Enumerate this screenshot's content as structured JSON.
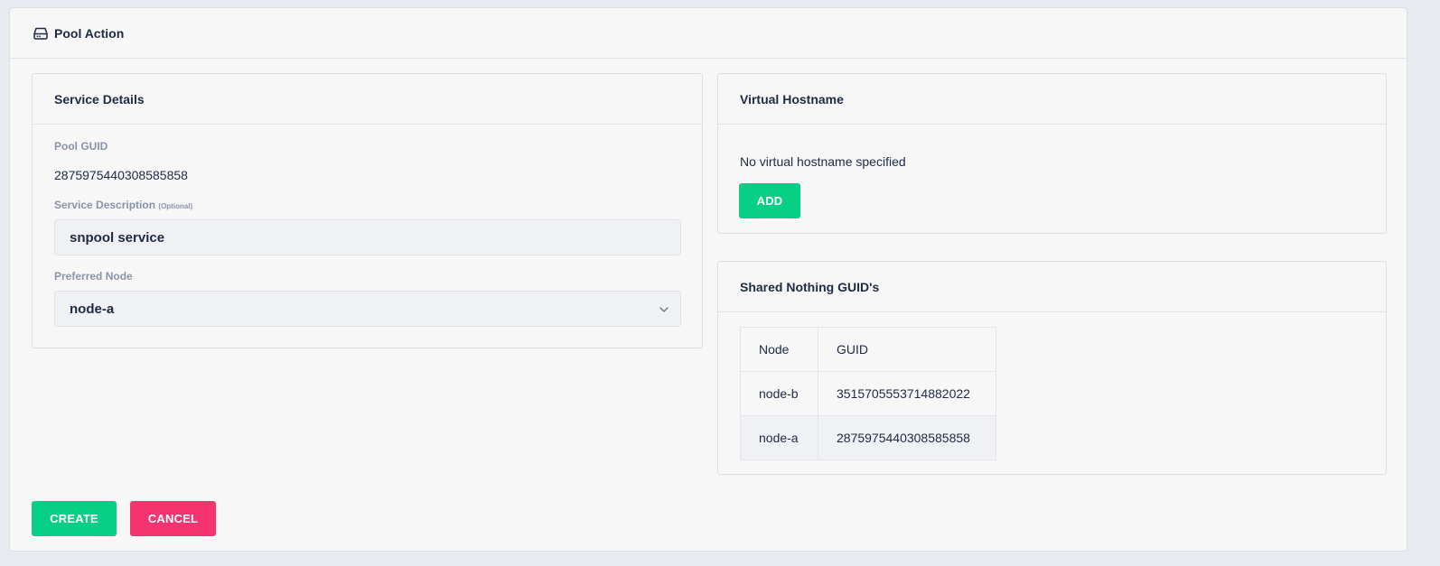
{
  "page": {
    "title": "Pool Action",
    "title_icon": "hard-drive-icon"
  },
  "service_details": {
    "title": "Service Details",
    "pool_guid_label": "Pool GUID",
    "pool_guid_value": "2875975440308585858",
    "description_label": "Service Description",
    "description_optional": "(Optional)",
    "description_value": "snpool service",
    "preferred_node_label": "Preferred Node",
    "preferred_node_value": "node-a"
  },
  "virtual_hostname": {
    "title": "Virtual Hostname",
    "empty_text": "No virtual hostname specified",
    "add_label": "ADD"
  },
  "shared_nothing": {
    "title": "Shared Nothing GUID's",
    "headers": [
      "Node",
      "GUID"
    ],
    "rows": [
      {
        "node": "node-b",
        "guid": "3515705553714882022"
      },
      {
        "node": "node-a",
        "guid": "2875975440308585858"
      }
    ]
  },
  "actions": {
    "create_label": "CREATE",
    "cancel_label": "CANCEL"
  },
  "colors": {
    "primary_green": "#07cf86",
    "danger_red": "#f5336e"
  }
}
